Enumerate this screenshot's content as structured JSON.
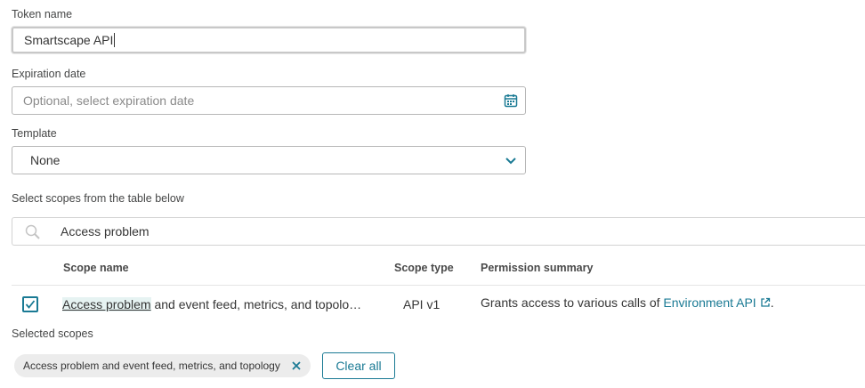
{
  "form": {
    "token_name": {
      "label": "Token name",
      "value": "Smartscape API"
    },
    "expiration": {
      "label": "Expiration date",
      "placeholder": "Optional, select expiration date",
      "icon": "calendar-icon"
    },
    "template": {
      "label": "Template",
      "value": "None",
      "icon": "chevron-down-icon"
    },
    "scopes_label": "Select scopes from the table below",
    "search": {
      "value": "Access problem",
      "icon": "search-icon"
    }
  },
  "table": {
    "headers": {
      "scope_name": "Scope name",
      "scope_type": "Scope type",
      "permission": "Permission summary"
    },
    "rows": [
      {
        "checked": true,
        "name_match": "Access problem",
        "name_rest": " and event feed, metrics, and topolo…",
        "type": "API v1",
        "summary_prefix": "Grants access to various calls of ",
        "summary_link": "Environment API",
        "summary_suffix": "."
      }
    ]
  },
  "selected": {
    "label": "Selected scopes",
    "chips": [
      "Access problem and event feed, metrics, and topology"
    ],
    "clear_label": "Clear all"
  },
  "colors": {
    "accent": "#1a7a94",
    "highlight": "#e6f3f2",
    "chip_bg": "#ececec"
  }
}
